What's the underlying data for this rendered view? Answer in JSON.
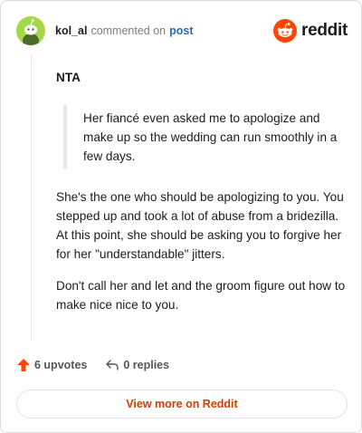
{
  "header": {
    "username": "kol_al",
    "action_text": "commented on",
    "post_link": "post",
    "brand_word": "reddit"
  },
  "comment": {
    "heading": "NTA",
    "quote": "Her fiancé even asked me to apologize and make up so the wedding can run smoothly in a few days.",
    "paragraphs": [
      "She's the one who should be apologizing to you. You stepped up and took a lot of abuse from a bridezilla. At this point, she should be asking you to forgive her for her \"understandable\" jitters.",
      "Don't call her and let and the groom figure out how to make nice nice to you."
    ]
  },
  "footer": {
    "upvotes_label": "6 upvotes",
    "replies_label": "0 replies",
    "view_more_label": "View more on Reddit"
  },
  "colors": {
    "avatar_bg": "#a5d848",
    "brand_orange": "#ff4500",
    "link_blue": "#2b6cb0",
    "view_more_text": "#d93a00",
    "upvote_icon": "#ff4500"
  },
  "icons": {
    "avatar": "snoo-avatar-icon",
    "brand": "reddit-logo-icon",
    "upvote": "upvote-arrow-icon",
    "reply": "reply-arrow-icon"
  }
}
